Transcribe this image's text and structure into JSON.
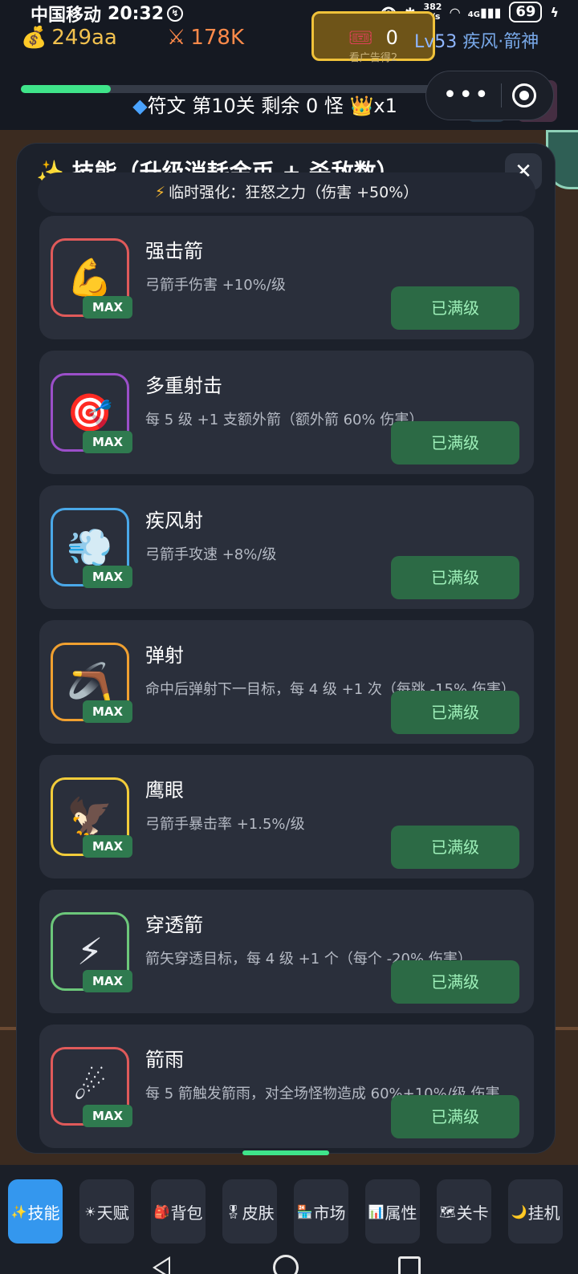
{
  "status_bar": {
    "carrier": "中国移动",
    "time": "20:32",
    "notif_badge": "↯",
    "net_speed_value": "382",
    "net_speed_unit": "B/s",
    "signal": "4G",
    "battery": "69"
  },
  "hud": {
    "gold_icon": "money-bag-icon",
    "gold": "249aa",
    "attack_icon": "crossed-swords-icon",
    "attack": "178K",
    "ad_tickets": "0",
    "ad_label": "看广告得2",
    "level_prefix": "Lv",
    "level_number": "53",
    "class_name": "疾风·箭神",
    "xp_fraction": 0.17,
    "stage_text": "符文 第10关  剩余 0 怪",
    "crown_multiplier": "x1"
  },
  "panel": {
    "title": "技能（升级消耗金币 + 杀敌数）",
    "close_label": "✕",
    "buff_text": "临时强化：狂怒之力（伤害 +50%）"
  },
  "skills": [
    {
      "name": "强击箭",
      "desc": "弓箭手伤害 +10%/级",
      "icon": "💪",
      "icon_name": "flexed-bicep-icon",
      "border": "#e05a5a",
      "badge": "MAX",
      "button": "已满级"
    },
    {
      "name": "多重射击",
      "desc": "每 5 级 +1 支额外箭（额外箭 60% 伤害）",
      "icon": "🎯",
      "icon_name": "bullseye-icon",
      "border": "#9b4fc9",
      "badge": "MAX",
      "button": "已满级"
    },
    {
      "name": "疾风射",
      "desc": "弓箭手攻速 +8%/级",
      "icon": "💨",
      "icon_name": "wind-icon",
      "border": "#4aa8e8",
      "badge": "MAX",
      "button": "已满级"
    },
    {
      "name": "弹射",
      "desc": "命中后弹射下一目标，每 4 级 +1 次（每跳 -15% 伤害）",
      "icon": "🪃",
      "icon_name": "boomerang-icon",
      "border": "#f0a030",
      "badge": "MAX",
      "button": "已满级"
    },
    {
      "name": "鹰眼",
      "desc": "弓箭手暴击率 +1.5%/级",
      "icon": "🦅",
      "icon_name": "eagle-icon",
      "border": "#f2cc3a",
      "badge": "MAX",
      "button": "已满级"
    },
    {
      "name": "穿透箭",
      "desc": "箭矢穿透目标，每 4 级 +1 个（每个 -20% 伤害）",
      "icon": "⚡",
      "icon_name": "lightning-icon",
      "border": "#6cc77a",
      "badge": "MAX",
      "button": "已满级"
    },
    {
      "name": "箭雨",
      "desc": "每 5 箭触发箭雨，对全场怪物造成 60%+10%/级 伤害",
      "icon": "☄",
      "icon_name": "comet-icon",
      "border": "#e05a5a",
      "badge": "MAX",
      "button": "已满级"
    }
  ],
  "bottom_nav": [
    {
      "label": "技能",
      "icon": "✨",
      "icon_name": "sparkles-icon",
      "active": true
    },
    {
      "label": "天赋",
      "icon": "☀",
      "icon_name": "sun-icon",
      "active": false
    },
    {
      "label": "背包",
      "icon": "🎒",
      "icon_name": "backpack-icon",
      "active": false
    },
    {
      "label": "皮肤",
      "icon": "🎖",
      "icon_name": "medal-icon",
      "active": false
    },
    {
      "label": "市场",
      "icon": "🏪",
      "icon_name": "shop-icon",
      "active": false
    },
    {
      "label": "属性",
      "icon": "📊",
      "icon_name": "chart-icon",
      "active": false
    },
    {
      "label": "关卡",
      "icon": "🗺",
      "icon_name": "map-icon",
      "active": false
    },
    {
      "label": "挂机",
      "icon": "🌙",
      "icon_name": "moon-icon",
      "active": false
    }
  ]
}
